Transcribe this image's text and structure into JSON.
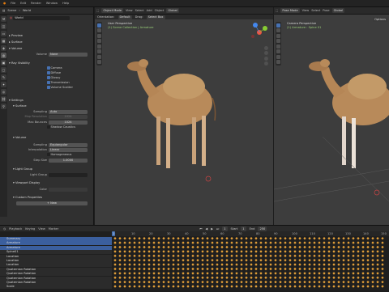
{
  "top_menu": [
    "File",
    "Edit",
    "Render",
    "Window",
    "Help"
  ],
  "props": {
    "header_items": [
      "Scene",
      "World"
    ],
    "world_name": "World",
    "sections": {
      "preview": "Preview",
      "surface": "Surface",
      "volume": "Volume",
      "ray_visibility": "Ray Visibility",
      "settings": "Settings",
      "surface_sub": "Surface",
      "volume_sub": "Volume",
      "light_group": "Light Group",
      "viewport_display": "Viewport Display",
      "custom_props": "Custom Properties"
    },
    "volume_label": "Volume",
    "volume_value": "None",
    "ray_checks": [
      {
        "label": "Camera",
        "on": true
      },
      {
        "label": "Diffuse",
        "on": true
      },
      {
        "label": "Glossy",
        "on": true
      },
      {
        "label": "Transmission",
        "on": true
      },
      {
        "label": "Volume Scatter",
        "on": true
      }
    ],
    "sampling_label": "Sampling",
    "sampling_value": "Auto",
    "map_resolution_label": "Map Resolution",
    "map_resolution_value": "1024",
    "max_bounces_label": "Max Bounces",
    "max_bounces_value": "1024",
    "shadow_caustics": "Shadow Caustics",
    "vol_sampling_label": "Sampling",
    "vol_sampling_value": "Equiangular",
    "interpolation_label": "Interpolation",
    "interpolation_value": "Linear",
    "homogeneous": "Homogeneous",
    "step_size_label": "Step Size",
    "step_size_value": "1.0000",
    "light_group_label": "Light Group",
    "color_label": "Color",
    "new_button": "New"
  },
  "viewport_left": {
    "mode": "Object Mode",
    "menus": [
      "View",
      "Select",
      "Add",
      "Object"
    ],
    "transform": "Global",
    "title": "User Perspective",
    "subtitle": "(1) Scene Collection | Armature",
    "orientation_label": "Orientation:",
    "orientation_value": "Default",
    "drag_label": "Drag:",
    "drag_value": "Select Box"
  },
  "viewport_right": {
    "mode": "Pose Mode",
    "menus": [
      "View",
      "Select",
      "Pose"
    ],
    "transform": "Global",
    "options": "Options",
    "title": "Camera Perspective",
    "subtitle": "(1) Armature : Spine 01"
  },
  "timeline": {
    "header": [
      "Playback",
      "Keying",
      "View",
      "Marker"
    ],
    "frame": "1",
    "start_label": "Start",
    "start_value": "1",
    "end_label": "End",
    "end_value": "250",
    "ruler_ticks": [
      "0",
      "10",
      "20",
      "30",
      "40",
      "50",
      "60",
      "70",
      "80",
      "90",
      "100",
      "110",
      "120",
      "130",
      "140",
      "150"
    ],
    "channels": [
      {
        "label": "Summary",
        "color": "#3b5f9e"
      },
      {
        "label": "Armature",
        "color": "#3b5f9e"
      },
      {
        "label": "Armature",
        "color": "#3b5f9e"
      },
      {
        "label": "Spine01",
        "color": "#2b2b2b"
      },
      {
        "label": "Location",
        "color": "#2b2b2b"
      },
      {
        "label": "Location",
        "color": "#2b2b2b"
      },
      {
        "label": "Location",
        "color": "#2b2b2b"
      },
      {
        "label": "Quaternion Rotation",
        "color": "#2b2b2b"
      },
      {
        "label": "Quaternion Rotation",
        "color": "#2b2b2b"
      },
      {
        "label": "Quaternion Rotation",
        "color": "#2b2b2b"
      },
      {
        "label": "Quaternion Rotation",
        "color": "#2b2b2b"
      },
      {
        "label": "Scale",
        "color": "#2b2b2b"
      }
    ]
  },
  "colors": {
    "accent": "#4772b3",
    "keyframe": "#e8a33a",
    "bg": "#3d3d3d"
  }
}
